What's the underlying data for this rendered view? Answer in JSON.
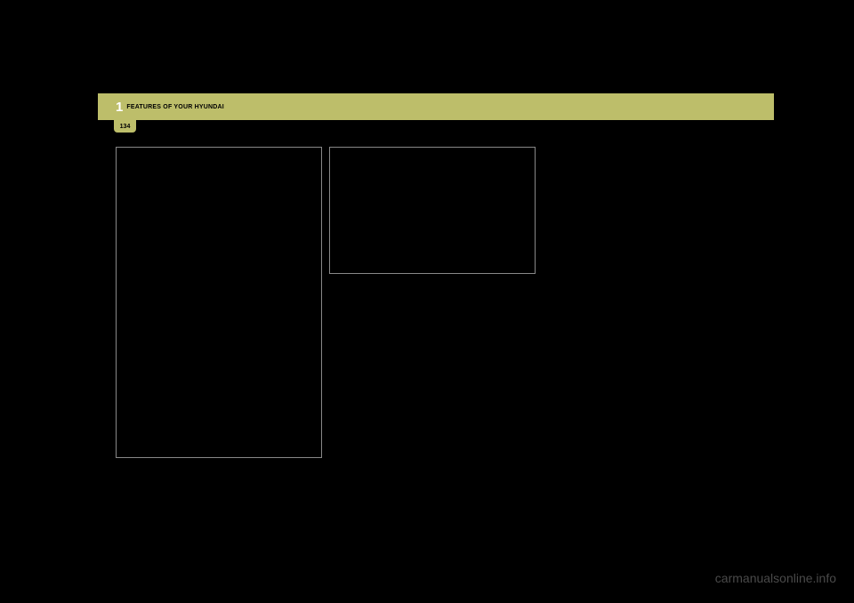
{
  "header": {
    "chapter_number": "1",
    "chapter_title": "FEATURES OF YOUR HYUNDAI"
  },
  "page": {
    "number": "134"
  },
  "watermark": "carmanualsonline.info"
}
